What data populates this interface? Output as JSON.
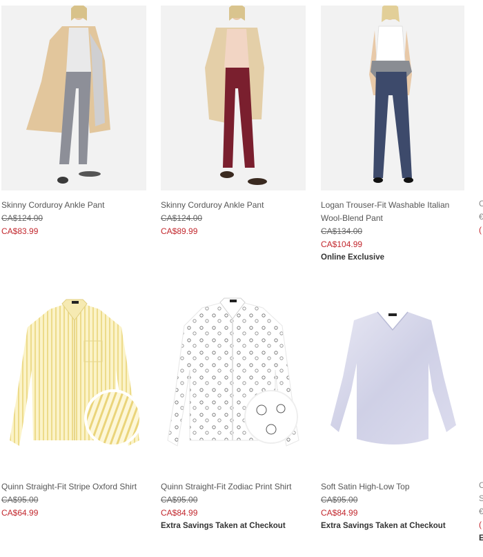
{
  "products": [
    {
      "name": "Skinny Corduroy Ankle Pant",
      "price_was": "CA$124.00",
      "price_now": "CA$83.99",
      "badge": "",
      "image": "woman-camel-coat-grey-pants"
    },
    {
      "name": "Skinny Corduroy Ankle Pant",
      "price_was": "CA$124.00",
      "price_now": "CA$89.99",
      "badge": "",
      "image": "woman-trench-burgundy-pants"
    },
    {
      "name_line1": "Logan Trouser-Fit Washable Italian",
      "name_line2": "Wool-Blend Pant",
      "price_was": "CA$134.00",
      "price_now": "CA$104.99",
      "badge": "Online Exclusive",
      "image": "woman-white-tank-navy-trousers"
    },
    {
      "name": "Quinn Straight-Fit Stripe Oxford Shirt",
      "price_was": "CA$95.00",
      "price_now": "CA$64.99",
      "badge": "",
      "image": "yellow-stripe-shirt"
    },
    {
      "name": "Quinn Straight-Fit Zodiac Print Shirt",
      "price_was": "CA$95.00",
      "price_now": "CA$84.99",
      "badge": "Extra Savings Taken at Checkout",
      "image": "white-zodiac-print-shirt"
    },
    {
      "name": "Soft Satin High-Low Top",
      "price_was": "CA$95.00",
      "price_now": "CA$84.99",
      "badge": "Extra Savings Taken at Checkout",
      "image": "lavender-satin-top"
    }
  ],
  "colors": {
    "sale_price": "#c2272d",
    "text": "#555555",
    "image_bg": "#f2f2f2"
  }
}
